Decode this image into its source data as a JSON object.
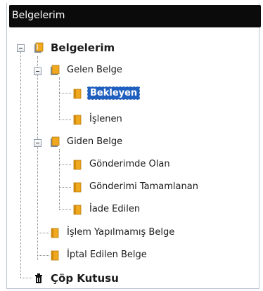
{
  "window": {
    "title": "Belgelerim"
  },
  "tree": {
    "root": "Belgelerim",
    "gelen": "Gelen Belge",
    "bekleyen": "Bekleyen",
    "islenen": "İşlenen",
    "giden": "Giden Belge",
    "gonderimde": "Gönderimde Olan",
    "tamamlanan": "Gönderimi Tamamlanan",
    "iade": "İade Edilen",
    "islem_yapilmamis": "İşlem Yapılmamış Belge",
    "iptal": "İptal Edilen Belge",
    "cop": "Çöp Kutusu",
    "selected_item": "Bekleyen"
  },
  "colors": {
    "selection": "#1f5fbf",
    "folder": "#f0a81e",
    "titlebar": "#0b0b0b"
  },
  "icons": {
    "book": "book-icon",
    "folder": "folder-icon",
    "trash": "trash-icon",
    "expander": "collapse-icon"
  }
}
